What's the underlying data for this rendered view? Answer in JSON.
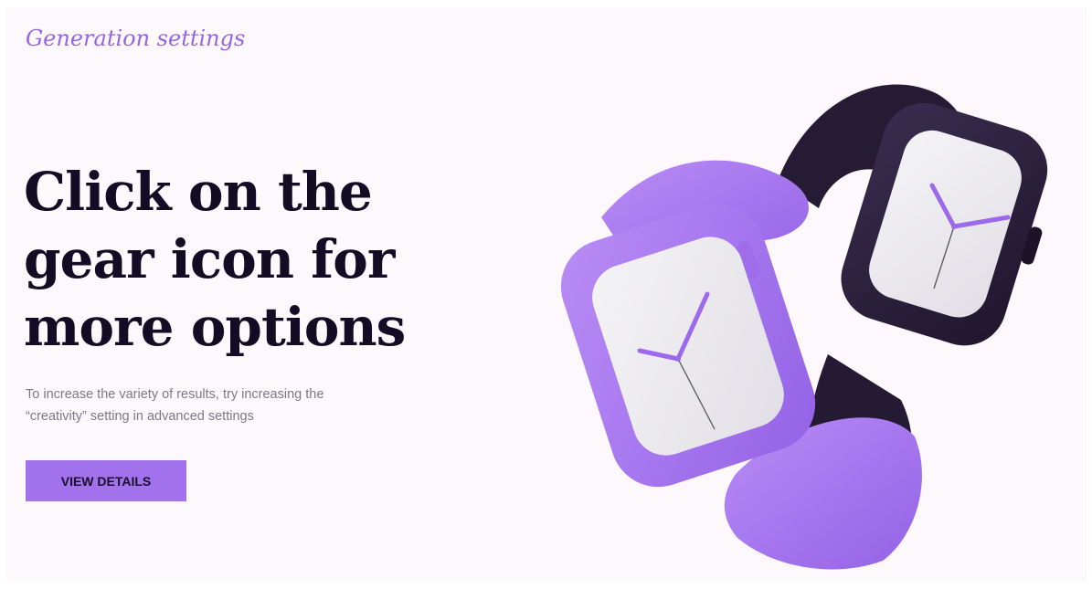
{
  "hero": {
    "eyebrow": "Generation settings",
    "headline_lines": [
      "Click on the",
      "gear icon for",
      "more options"
    ],
    "description_lines": [
      "To increase the variety of results, try increasing the",
      "“creativity” setting in advanced settings"
    ],
    "cta_label": "VIEW DETAILS"
  },
  "illustration": {
    "name": "smartwatches-illustration",
    "colors": {
      "purple_band": "#a475ee",
      "dark_band": "#251b35",
      "watch_face": "#ecebee",
      "hand_accent": "#9c69ec",
      "page_background": "#fdf8fc"
    }
  }
}
